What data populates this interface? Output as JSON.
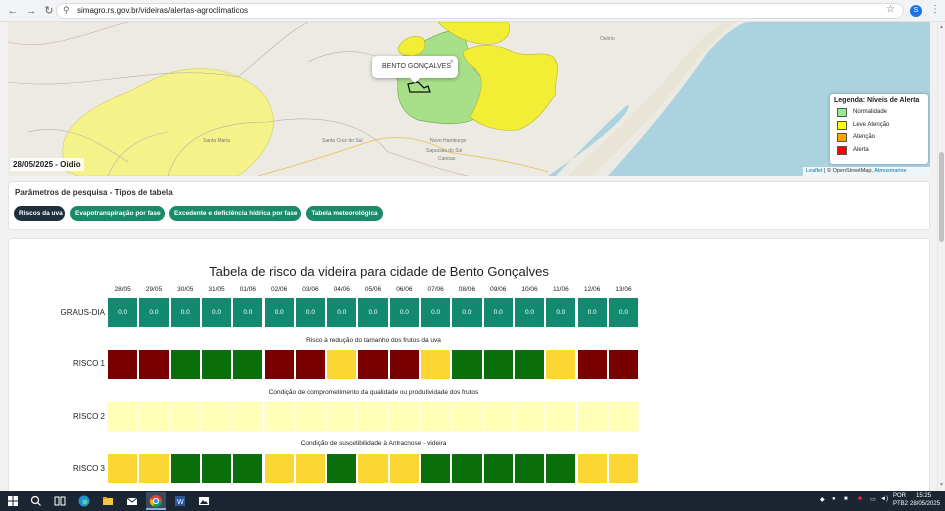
{
  "browser": {
    "url": "simagro.rs.gov.br/videiras/alertas-agroclimaticos",
    "profile_initial": "S"
  },
  "map": {
    "date_label": "28/05/2025 - Oídio",
    "popup_title": "BENTO GONÇALVES",
    "popup_close": "×",
    "legend_title": "Legenda: Níveis de Alerta",
    "legend": [
      {
        "label": "Normalidade",
        "color": "#90ee90"
      },
      {
        "label": "Leve Atenção",
        "color": "#ffff00"
      },
      {
        "label": "Atenção",
        "color": "#ffa500"
      },
      {
        "label": "Alerta",
        "color": "#ff0000"
      }
    ],
    "attribution_leaflet": "Leaflet",
    "attribution_osm": "| © OpenStreetMap,",
    "attribution_atmo": "Atmosmarine",
    "place_labels": {
      "santa_maria": "Santa Maria",
      "santa_cruz": "Santa Cruz do Sul",
      "novo_hamburgo": "Novo Hamburgo",
      "sapucaia": "Sapucaia do Sul",
      "canoas": "Canoas",
      "osorio": "Osório"
    }
  },
  "params": {
    "title": "Parâmetros de pesquisa - Tipos de tabela",
    "chips": [
      {
        "label": "Riscos da uva",
        "active": true
      },
      {
        "label": "Evapotranspiração por fase",
        "active": false
      },
      {
        "label": "Excedente e deficiência hídrica por fase",
        "active": false
      },
      {
        "label": "Tabela meteorológica",
        "active": false
      }
    ]
  },
  "table": {
    "title": "Tabela de risco da videira para cidade de Bento Gonçalves",
    "dates": [
      "28/05",
      "29/05",
      "30/05",
      "31/05",
      "01/06",
      "02/06",
      "03/06",
      "04/06",
      "05/06",
      "06/06",
      "07/06",
      "08/06",
      "09/06",
      "10/06",
      "11/06",
      "12/06",
      "13/06"
    ],
    "graus_label": "GRAUS-DIA",
    "graus_values": [
      "0.0",
      "0.0",
      "0.0",
      "0.0",
      "0.0",
      "0.0",
      "0.0",
      "0.0",
      "0.0",
      "0.0",
      "0.0",
      "0.0",
      "0.0",
      "0.0",
      "0.0",
      "0.0",
      "0.0"
    ],
    "risco1": {
      "caption": "Risco à redução do tamanho dos frutos da uva",
      "label": "RISCO 1",
      "colors": [
        "#7a0000",
        "#7a0000",
        "#0a6e0a",
        "#0a6e0a",
        "#0a6e0a",
        "#7a0000",
        "#7a0000",
        "#fcd733",
        "#7a0000",
        "#7a0000",
        "#fcd733",
        "#0a6e0a",
        "#0a6e0a",
        "#0a6e0a",
        "#fcd733",
        "#7a0000",
        "#7a0000"
      ]
    },
    "risco2": {
      "caption": "Condição de comprometimento da qualidade ou produtividade dos frutos",
      "label": "RISCO 2",
      "colors": [
        "#ffffb8",
        "#ffffb8",
        "#ffffb8",
        "#ffffb8",
        "#ffffb8",
        "#ffffb8",
        "#ffffb8",
        "#ffffb8",
        "#ffffb8",
        "#ffffb8",
        "#ffffb8",
        "#ffffb8",
        "#ffffb8",
        "#ffffb8",
        "#ffffb8",
        "#ffffb8",
        "#ffffb8"
      ]
    },
    "risco3": {
      "caption": "Condição de suscetibilidade à Antracnose - videira",
      "label": "RISCO 3",
      "colors": [
        "#fcd733",
        "#fcd733",
        "#0a6e0a",
        "#0a6e0a",
        "#0a6e0a",
        "#fcd733",
        "#fcd733",
        "#0a6e0a",
        "#fcd733",
        "#fcd733",
        "#0a6e0a",
        "#0a6e0a",
        "#0a6e0a",
        "#0a6e0a",
        "#0a6e0a",
        "#fcd733",
        "#fcd733"
      ]
    }
  },
  "taskbar": {
    "lang_top": "POR",
    "lang_bottom": "PTB2",
    "time": "15:25",
    "date": "28/05/2025"
  }
}
